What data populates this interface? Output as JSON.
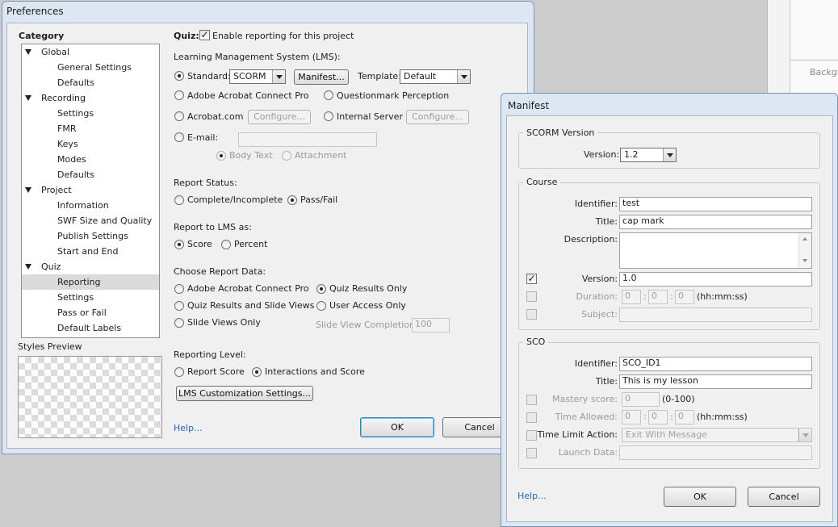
{
  "preferences": {
    "title": "Preferences",
    "category_label": "Category",
    "tree": [
      {
        "label": "Global",
        "level": 0
      },
      {
        "label": "General Settings",
        "level": 1
      },
      {
        "label": "Defaults",
        "level": 1
      },
      {
        "label": "Recording",
        "level": 0
      },
      {
        "label": "Settings",
        "level": 1
      },
      {
        "label": "FMR",
        "level": 1
      },
      {
        "label": "Keys",
        "level": 1
      },
      {
        "label": "Modes",
        "level": 1
      },
      {
        "label": "Defaults",
        "level": 1
      },
      {
        "label": "Project",
        "level": 0
      },
      {
        "label": "Information",
        "level": 1
      },
      {
        "label": "SWF Size and Quality",
        "level": 1
      },
      {
        "label": "Publish Settings",
        "level": 1
      },
      {
        "label": "Start and End",
        "level": 1
      },
      {
        "label": "Quiz",
        "level": 0
      },
      {
        "label": "Reporting",
        "level": 1,
        "selected": true
      },
      {
        "label": "Settings",
        "level": 1
      },
      {
        "label": "Pass or Fail",
        "level": 1
      },
      {
        "label": "Default Labels",
        "level": 1
      }
    ],
    "styles_preview_label": "Styles Preview",
    "quiz_label": "Quiz:",
    "enable_reporting": {
      "label": "Enable reporting for this project",
      "checked": true
    },
    "lms_label": "Learning Management System (LMS):",
    "standard": {
      "label": "Standard:",
      "selected": true,
      "value": "SCORM"
    },
    "manifest_button": "Manifest...",
    "template": {
      "label": "Template:",
      "value": "Default"
    },
    "acrobat_connect_pro": "Adobe Acrobat Connect Pro",
    "questionmark_perception": "Questionmark Perception",
    "acrobat_com": "Acrobat.com",
    "configure_label": "Configure...",
    "internal_server": "Internal Server",
    "email": {
      "label": "E-mail:",
      "value": ""
    },
    "body_text": "Body Text",
    "attachment": "Attachment",
    "report_status_label": "Report Status:",
    "complete_incomplete": "Complete/Incomplete",
    "pass_fail": "Pass/Fail",
    "report_to_lms_label": "Report to LMS as:",
    "score": "Score",
    "percent": "Percent",
    "choose_report_data_label": "Choose Report Data:",
    "report_data_acrobat": "Adobe Acrobat Connect Pro",
    "quiz_results_only": "Quiz Results Only",
    "quiz_results_slide_views": "Quiz Results and Slide Views",
    "user_access_only": "User Access Only",
    "slide_views_only": "Slide Views Only",
    "slide_view_completion": {
      "label": "Slide View Completion",
      "value": "100"
    },
    "reporting_level_label": "Reporting Level:",
    "report_score": "Report Score",
    "interactions_and_score": "Interactions and Score",
    "lms_customization_button": "LMS Customization Settings...",
    "help_link": "Help...",
    "ok_button": "OK",
    "cancel_button": "Cancel"
  },
  "manifest": {
    "title": "Manifest",
    "scorm_version_group": "SCORM Version",
    "version_label": "Version:",
    "version_value": "1.2",
    "course_group": "Course",
    "identifier_label": "Identifier:",
    "identifier_value": "test",
    "title_label": "Title:",
    "title_value": "cap mark",
    "description_label": "Description:",
    "description_value": "",
    "course_version_label": "Version:",
    "course_version_value": "1.0",
    "duration_label": "Duration:",
    "duration_h": "0",
    "duration_m": "0",
    "duration_s": "0",
    "time_format": "(hh:mm:ss)",
    "colon": ":",
    "subject_label": "Subject:",
    "sco_group": "SCO",
    "sco_identifier_label": "Identifier:",
    "sco_identifier_value": "SCO_ID1",
    "sco_title_label": "Title:",
    "sco_title_value": "This is my lesson",
    "mastery_label": "Mastery score:",
    "mastery_value": "0",
    "mastery_range": "(0-100)",
    "time_allowed_label": "Time Allowed:",
    "ta_h": "0",
    "ta_m": "0",
    "ta_s": "0",
    "time_limit_label": "Time Limit Action:",
    "time_limit_value": "Exit With Message",
    "launch_data_label": "Launch Data:",
    "help_link": "Help...",
    "ok_button": "OK",
    "cancel_button": "Cancel"
  },
  "background_app": {
    "panel_text": "Backgr"
  },
  "icons": [
    "checkmark-icon",
    "dropdown-arrow-icon",
    "tree-expand-icon",
    "scroll-up-icon",
    "scroll-down-icon"
  ]
}
